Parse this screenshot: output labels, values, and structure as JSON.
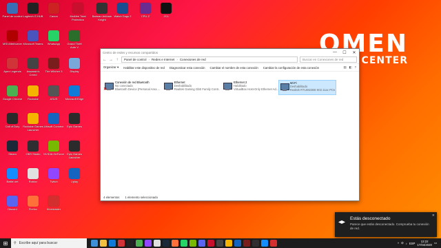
{
  "brand": {
    "line1": "OMEN",
    "line2": "COMMAND CENTER"
  },
  "desktop_icons": [
    {
      "label": "Panel de control",
      "color": "#3b6fb5"
    },
    {
      "label": "Logitech G HUB",
      "color": "#222222"
    },
    {
      "label": "Canon",
      "color": "#cc2222"
    },
    {
      "label": "McAfee Total Protection",
      "color": "#c8102e"
    },
    {
      "label": "Batman Arkham Knight",
      "color": "#333333"
    },
    {
      "label": "Watch Dogs 2",
      "color": "#1a4d8f"
    },
    {
      "label": "CPU-Z",
      "color": "#6a2c91"
    },
    {
      "label": "JC4",
      "color": "#111111"
    },
    {
      "label": "MSI Afterburner",
      "color": "#b00000"
    },
    {
      "label": "Microsoft Teams",
      "color": "#4b53bc"
    },
    {
      "label": "WhatsApp",
      "color": "#25d366"
    },
    {
      "label": "Grand Theft Auto V",
      "color": "#2b6e2b"
    },
    {
      "label": "Apex Legends",
      "color": "#d13438"
    },
    {
      "label": "Assassin's Creed",
      "color": "#444444"
    },
    {
      "label": "The Witcher 3",
      "color": "#7a1d1d"
    },
    {
      "label": "Display",
      "color": "#7aa7d9"
    },
    {
      "label": "Google Chrome",
      "color": "#4caf50"
    },
    {
      "label": "Rockstar",
      "color": "#f4b400"
    },
    {
      "label": "ASUS",
      "color": "#555555"
    },
    {
      "label": "Microsoft Edge",
      "color": "#0f7bd8"
    },
    {
      "label": "Call of Duty",
      "color": "#2a2a2a"
    },
    {
      "label": "Rockstar Games Launcher",
      "color": "#f4b400"
    },
    {
      "label": "Ubisoft Connect",
      "color": "#1565c0"
    },
    {
      "label": "Epic Games",
      "color": "#2b2b2b"
    },
    {
      "label": "Steam",
      "color": "#1b2838"
    },
    {
      "label": "OBS Studio",
      "color": "#302e31"
    },
    {
      "label": "NVIDIA GeForce",
      "color": "#76b900"
    },
    {
      "label": "Epic Games Launcher",
      "color": "#2b2b2b"
    },
    {
      "label": "Battle.net",
      "color": "#148eff"
    },
    {
      "label": "Roblox",
      "color": "#e0e0e0"
    },
    {
      "label": "Twitch",
      "color": "#9146ff"
    },
    {
      "label": "Uplay",
      "color": "#1565c0"
    },
    {
      "label": "Discord",
      "color": "#5865f2"
    },
    {
      "label": "Firefox",
      "color": "#ff7139"
    },
    {
      "label": "Kinemaster",
      "color": "#d32f2f"
    }
  ],
  "window": {
    "title": "Centro de redes y recursos compartidos",
    "min": "—",
    "max": "☐",
    "close": "✕",
    "address": {
      "part1": "Panel de control",
      "part2": "Redes e Internet",
      "part3": "Conexiones de red",
      "search_placeholder": "Buscar en Conexiones de red"
    },
    "toolbar": {
      "organize": "Organizar ▾",
      "disable": "Habilitar este dispositivo de red",
      "diagnose": "Diagnosticar esta conexión",
      "rename": "Cambiar el nombre de esta conexión",
      "settings": "Cambiar la configuración de esta conexión"
    },
    "adapters": [
      {
        "name": "Conexión de red Bluetooth",
        "status": "No conectado",
        "device": "Bluetooth Device (Personal Area ...",
        "disconnected": true,
        "selected": false
      },
      {
        "name": "Ethernet",
        "status": "Deshabilitado",
        "device": "Realtek Gaming GbE Family Contr...",
        "disconnected": false,
        "selected": false
      },
      {
        "name": "Ethernet 2",
        "status": "Habilitado",
        "device": "VirtualBox Host-Only Ethernet Ad...",
        "disconnected": false,
        "selected": false
      },
      {
        "name": "Wi-Fi",
        "status": "Deshabilitado",
        "device": "Realtek RTL8822BE 802.11ac PCIe ...",
        "disconnected": false,
        "selected": true
      }
    ],
    "status": {
      "count": "4 elementos",
      "selected": "1 elemento seleccionado"
    }
  },
  "toast": {
    "title": "Estás desconectado",
    "message": "Parece que estás desconectado. Comprueba tu conexión de red.",
    "close": "✕",
    "icon": "network-disconnected-icon"
  },
  "taskbar": {
    "search_placeholder": "Escribe aquí para buscar",
    "time": "13:22",
    "date": "17/04/2020",
    "lang": "ESP",
    "apps": [
      "#3f8ed8",
      "#f0c040",
      "#0f7bd8",
      "#d13438",
      "#222222",
      "#4caf50",
      "#9146ff",
      "#e0e0e0",
      "#1b2838",
      "#ff7139",
      "#25d366",
      "#76b900",
      "#5865f2",
      "#c8102e",
      "#444444",
      "#f4b400",
      "#1565c0",
      "#7a1d1d",
      "#302e31",
      "#148eff",
      "#d32f2f"
    ]
  }
}
